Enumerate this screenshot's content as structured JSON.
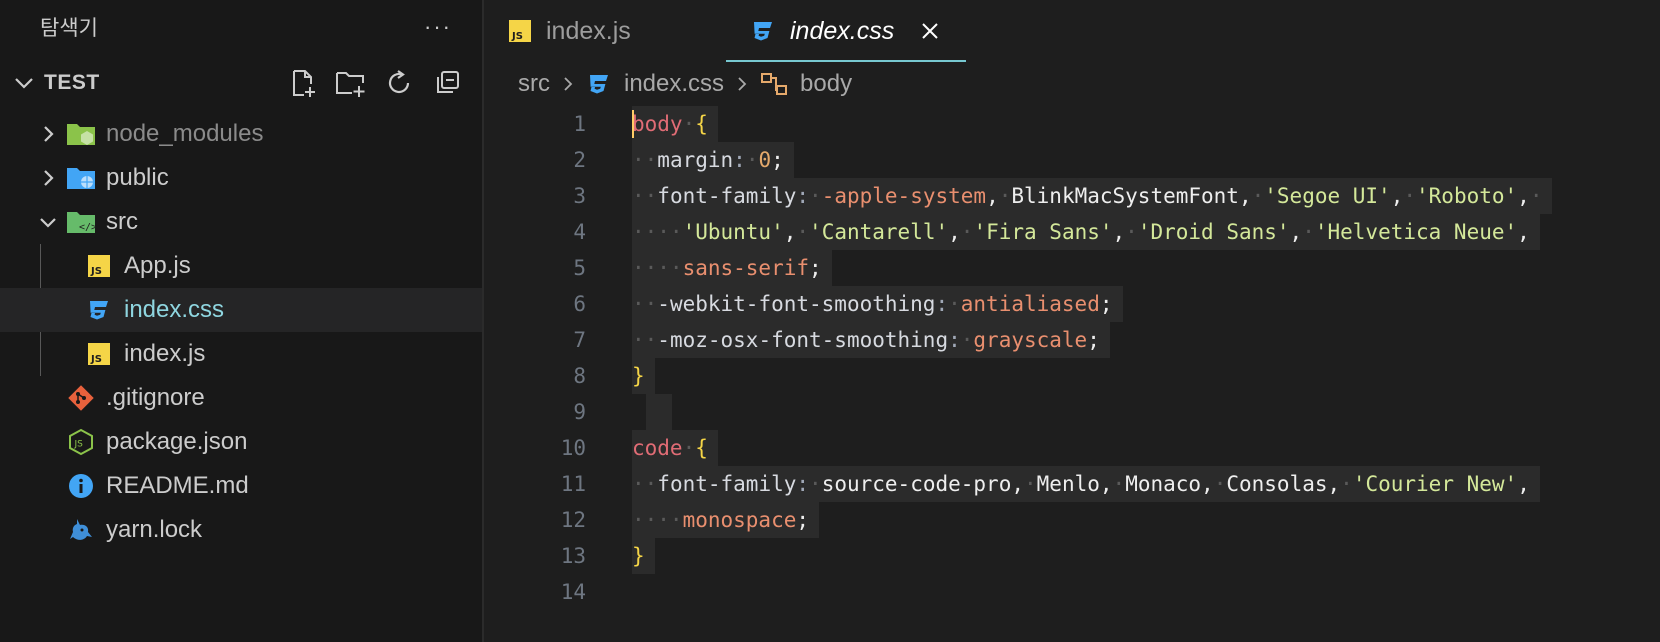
{
  "sidebar": {
    "title": "탐색기",
    "more": "···",
    "section_title": "TEST",
    "items": [
      {
        "label": "node_modules",
        "type": "folder",
        "icon": "node-folder-icon"
      },
      {
        "label": "public",
        "type": "folder",
        "icon": "public-folder-icon"
      },
      {
        "label": "src",
        "type": "folder-open",
        "icon": "src-folder-icon"
      },
      {
        "label": "App.js",
        "type": "file",
        "icon": "js-file-icon"
      },
      {
        "label": "index.css",
        "type": "file",
        "icon": "css-file-icon"
      },
      {
        "label": "index.js",
        "type": "file",
        "icon": "js-file-icon"
      },
      {
        "label": ".gitignore",
        "type": "file",
        "icon": "git-file-icon"
      },
      {
        "label": "package.json",
        "type": "file",
        "icon": "node-js-file-icon"
      },
      {
        "label": "README.md",
        "type": "file",
        "icon": "info-icon"
      },
      {
        "label": "yarn.lock",
        "type": "file",
        "icon": "yarn-icon"
      }
    ]
  },
  "tabs": [
    {
      "label": "index.js",
      "icon": "js-file-icon",
      "active": false
    },
    {
      "label": "index.css",
      "icon": "css-file-icon",
      "active": true
    }
  ],
  "breadcrumb": {
    "folder": "src",
    "file": "index.css",
    "symbol": "body"
  },
  "code": {
    "line_numbers": [
      "1",
      "2",
      "3",
      "4",
      "5",
      "6",
      "7",
      "8",
      "9",
      "10",
      "11",
      "12",
      "13",
      "14"
    ]
  },
  "colors": {
    "accent": "#77c8d1",
    "js_icon": "#f5d547",
    "css_icon": "#42a5f5",
    "folder_green": "#8bc34a",
    "folder_blue": "#42a5f5"
  }
}
